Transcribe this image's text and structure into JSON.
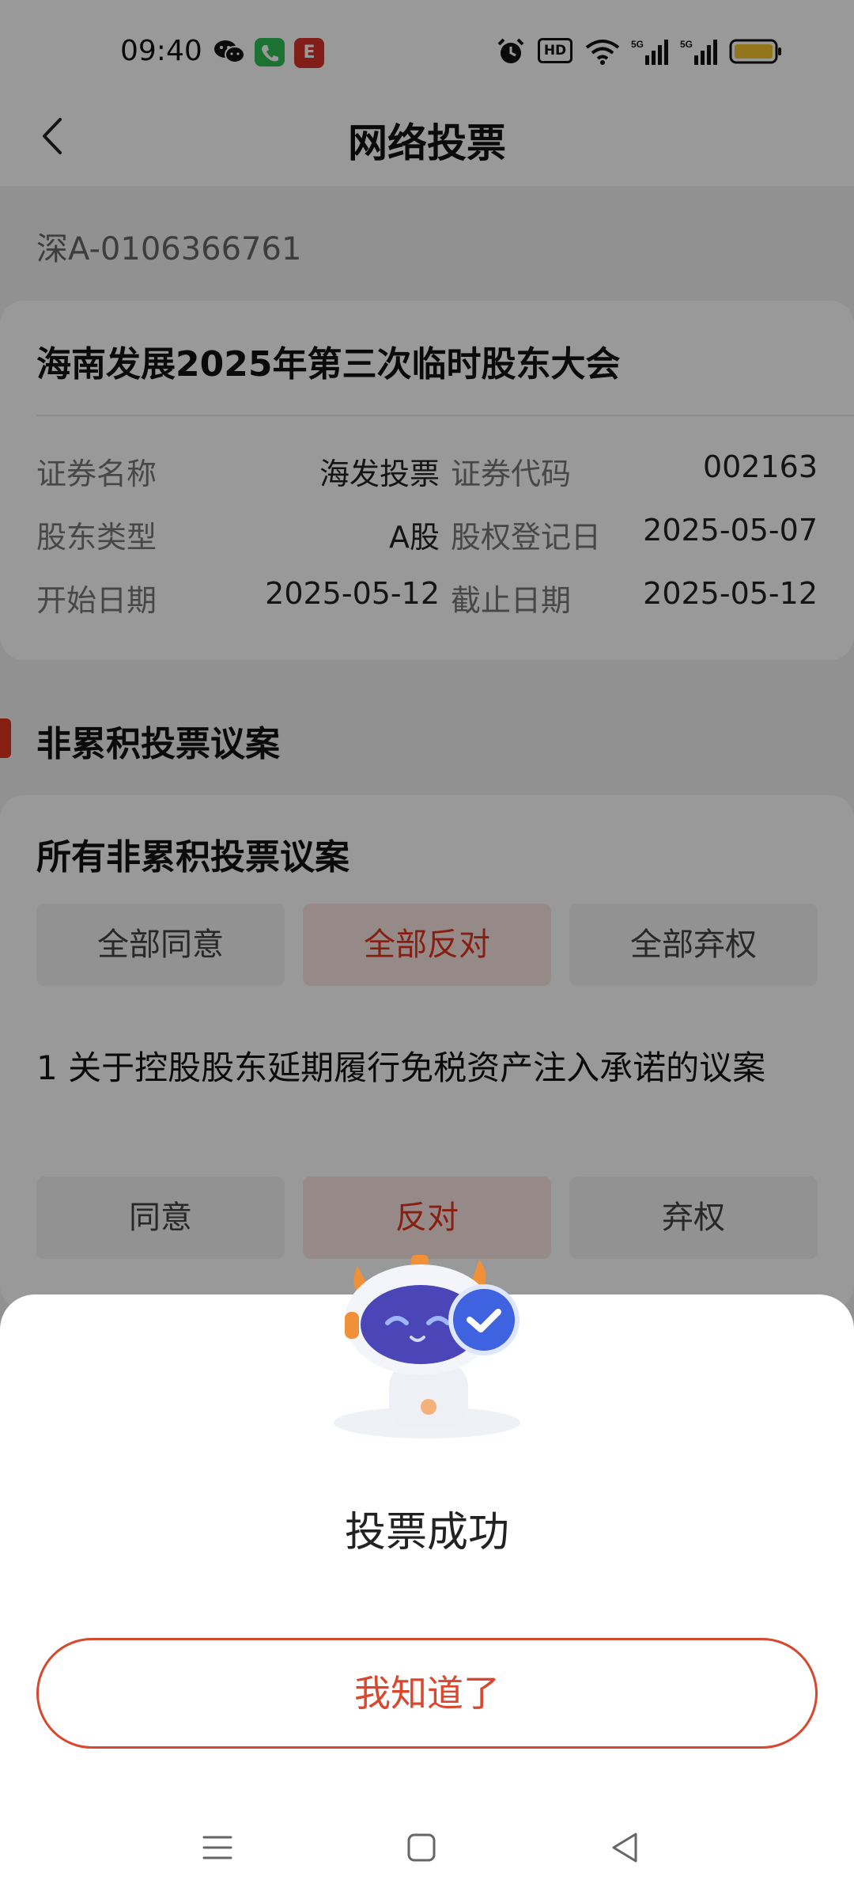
{
  "status_bar": {
    "time": "09:40",
    "app_badge": "E",
    "hd_label": "HD",
    "icons": [
      "wechat-icon",
      "phone-icon",
      "e-app-icon",
      "alarm-icon",
      "hd-icon",
      "wifi-icon",
      "signal-5g-icon",
      "signal-5g-icon",
      "battery-icon"
    ],
    "battery_color": "#f5c330"
  },
  "header": {
    "title": "网络投票",
    "back_icon": "chevron-left-icon"
  },
  "account": "深A-0106366761",
  "meeting": {
    "title": "海南发展2025年第三次临时股东大会",
    "info": [
      {
        "label1": "证券名称",
        "value1": "海发投票",
        "label2": "证券代码",
        "value2": "002163"
      },
      {
        "label1": "股东类型",
        "value1": "A股",
        "label2": "股权登记日",
        "value2": "2025-05-07"
      },
      {
        "label1": "开始日期",
        "value1": "2025-05-12",
        "label2": "截止日期",
        "value2": "2025-05-12"
      }
    ]
  },
  "section": {
    "title": "非累积投票议案",
    "accent_color": "#e0341f"
  },
  "vote": {
    "all_title": "所有非累积投票议案",
    "all_options": [
      "全部同意",
      "全部反对",
      "全部弃权"
    ],
    "all_selected": "全部反对",
    "proposal_title": "1 关于控股股东延期履行免税资产注入承诺的议案",
    "options": [
      "同意",
      "反对",
      "弃权"
    ],
    "selected": "反对"
  },
  "dialog": {
    "mascot": "robot-mascot-check-icon",
    "message": "投票成功",
    "button": "我知道了",
    "button_color": "#d9472f"
  },
  "nav_bar": {
    "icons": [
      "menu-icon",
      "home-icon",
      "back-triangle-icon"
    ]
  }
}
